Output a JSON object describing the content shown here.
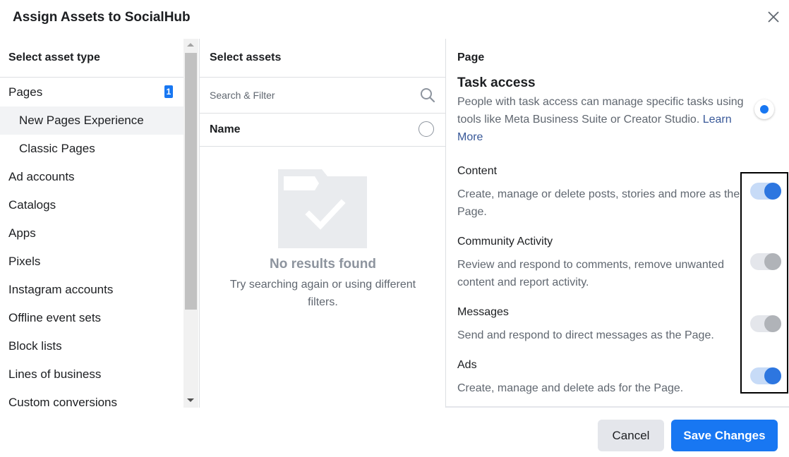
{
  "dialog": {
    "title": "Assign Assets to SocialHub"
  },
  "asset_types": {
    "heading": "Select asset type",
    "pages_badge": "1",
    "items": [
      {
        "label": "Pages",
        "sub": false
      },
      {
        "label": "New Pages Experience",
        "sub": true,
        "active": true
      },
      {
        "label": "Classic Pages",
        "sub": true
      },
      {
        "label": "Ad accounts",
        "sub": false
      },
      {
        "label": "Catalogs",
        "sub": false
      },
      {
        "label": "Apps",
        "sub": false
      },
      {
        "label": "Pixels",
        "sub": false
      },
      {
        "label": "Instagram accounts",
        "sub": false
      },
      {
        "label": "Offline event sets",
        "sub": false
      },
      {
        "label": "Block lists",
        "sub": false
      },
      {
        "label": "Lines of business",
        "sub": false
      },
      {
        "label": "Custom conversions",
        "sub": false
      }
    ]
  },
  "select_assets": {
    "heading": "Select assets",
    "search_placeholder": "Search & Filter",
    "name_header": "Name",
    "empty_title": "No results found",
    "empty_desc": "Try searching again or using different filters."
  },
  "permissions": {
    "heading": "Page",
    "task_access": {
      "title": "Task access",
      "desc": "People with task access can manage specific tasks using tools like Meta Business Suite or Creator Studio.",
      "learn_more": "Learn More",
      "selected": true
    },
    "items": [
      {
        "title": "Content",
        "desc": "Create, manage or delete posts, stories and more as the Page.",
        "enabled": true
      },
      {
        "title": "Community Activity",
        "desc": "Review and respond to comments, remove unwanted content and report activity.",
        "enabled": false
      },
      {
        "title": "Messages",
        "desc": "Send and respond to direct messages as the Page.",
        "enabled": false
      },
      {
        "title": "Ads",
        "desc": "Create, manage and delete ads for the Page.",
        "enabled": true
      }
    ]
  },
  "footer": {
    "cancel": "Cancel",
    "save": "Save Changes"
  },
  "colors": {
    "accent": "#1877f2",
    "toggle_on_track": "#c7dbf7",
    "toggle_on_knob": "#2d76e0",
    "toggle_off_knob": "#b0b3b8"
  },
  "icons": {
    "close": "close-icon",
    "search": "search-icon",
    "empty": "empty-folder-check-illustration"
  }
}
